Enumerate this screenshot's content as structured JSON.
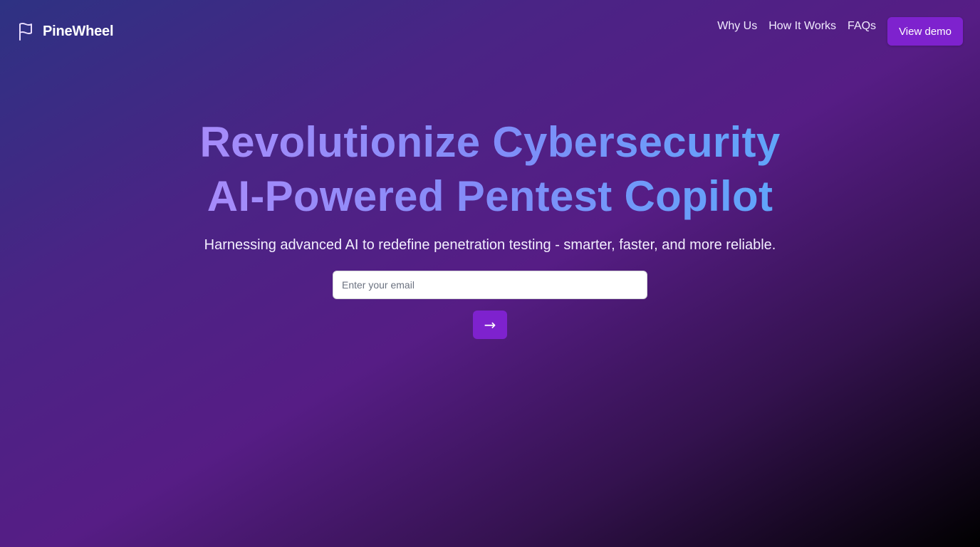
{
  "nav": {
    "brand": {
      "icon": "flag-icon",
      "name": "PineWheel"
    },
    "links": [
      {
        "label": "Why Us"
      },
      {
        "label": "How It Works"
      },
      {
        "label": "FAQs"
      }
    ],
    "demo_button": "View demo"
  },
  "hero": {
    "headline_line1": "Revolutionize Cybersecurity",
    "headline_line2": "AI-Powered Pentest Copilot",
    "subheadline": "Harnessing advanced AI to redefine penetration testing - smarter, faster, and more reliable.",
    "email_placeholder": "Enter your email",
    "email_value": "",
    "submit_icon": "arrow-right-icon",
    "submit_glyph": "→"
  },
  "colors": {
    "accent": "#7e22ce",
    "gradient_text_start": "#a78bfa",
    "gradient_text_end": "#60a5fa"
  }
}
